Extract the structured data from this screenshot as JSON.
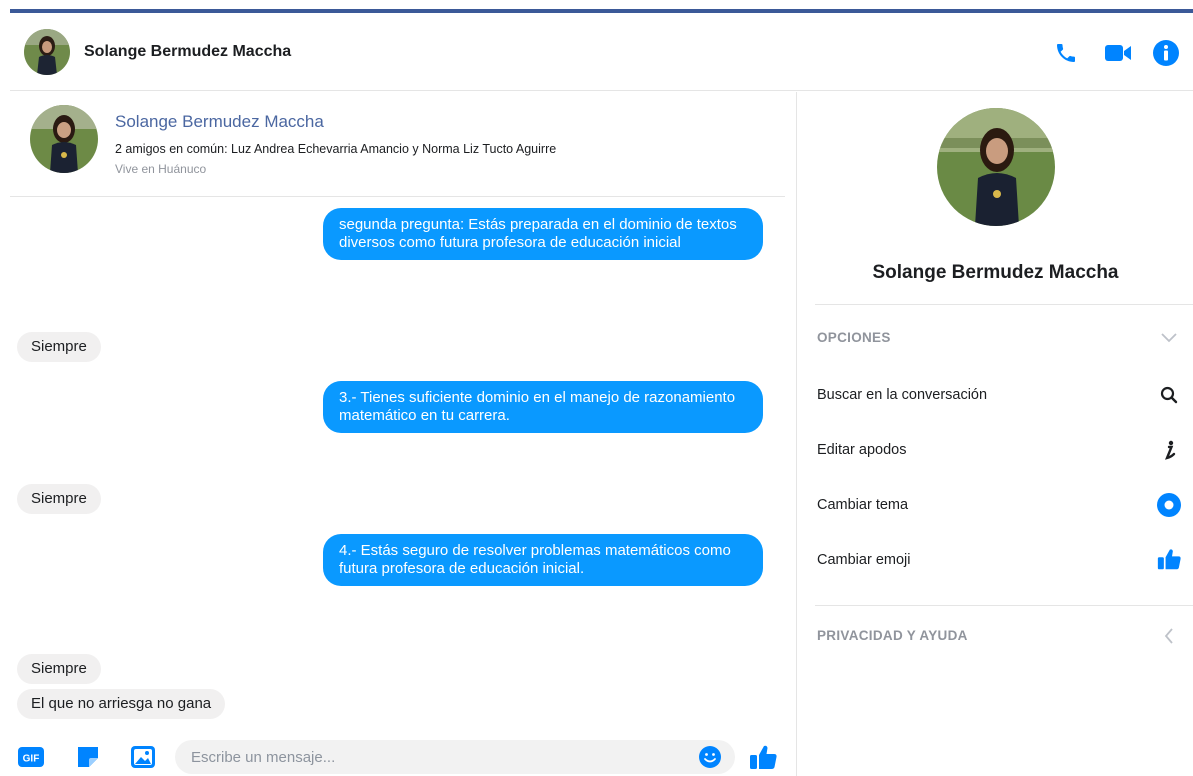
{
  "header": {
    "name": "Solange Bermudez Maccha",
    "icons": [
      "phone-icon",
      "video-icon",
      "info-icon"
    ]
  },
  "profile_card": {
    "name": "Solange Bermudez Maccha",
    "mutual_friends": "2 amigos en común: Luz Andrea Echevarria Amancio y Norma Liz Tucto Aguirre",
    "lives_in": "Vive en Huánuco"
  },
  "messages": [
    {
      "from": "me",
      "text": "segunda pregunta: Estás  preparada en el dominio  de textos  diversos como  futura profesora de educación inicial"
    },
    {
      "from": "them",
      "text": "Siempre"
    },
    {
      "from": "me",
      "text": "3.- Tienes  suficiente dominio  en el manejo  de razonamiento  matemático en tu carrera."
    },
    {
      "from": "them",
      "text": "Siempre"
    },
    {
      "from": "me",
      "text": "4.- Estás  seguro  de resolver  problemas matemáticos como  futura  profesora de educación  inicial."
    },
    {
      "from": "them",
      "text": "Siempre"
    },
    {
      "from": "them",
      "text": "El que no arriesga no gana"
    }
  ],
  "composer": {
    "placeholder": "Escribe un mensaje...",
    "gif_label": "GIF",
    "icons": [
      "gif-icon",
      "sticker-icon",
      "image-icon",
      "emoji-icon",
      "like-icon"
    ]
  },
  "sidebar": {
    "name": "Solange Bermudez Maccha",
    "options_title": "OPCIONES",
    "options": [
      {
        "label": "Buscar en la conversación",
        "icon": "search-icon"
      },
      {
        "label": "Editar apodos",
        "icon": "edit-nickname-icon"
      },
      {
        "label": "Cambiar tema",
        "icon": "theme-icon"
      },
      {
        "label": "Cambiar emoji",
        "icon": "like-icon"
      }
    ],
    "privacy_title": "PRIVACIDAD Y AYUDA"
  },
  "colors": {
    "accent": "#0084ff",
    "my_bubble": "#0a99ff",
    "their_bubble": "#f1f0f0",
    "top_line": "#3b5998"
  }
}
